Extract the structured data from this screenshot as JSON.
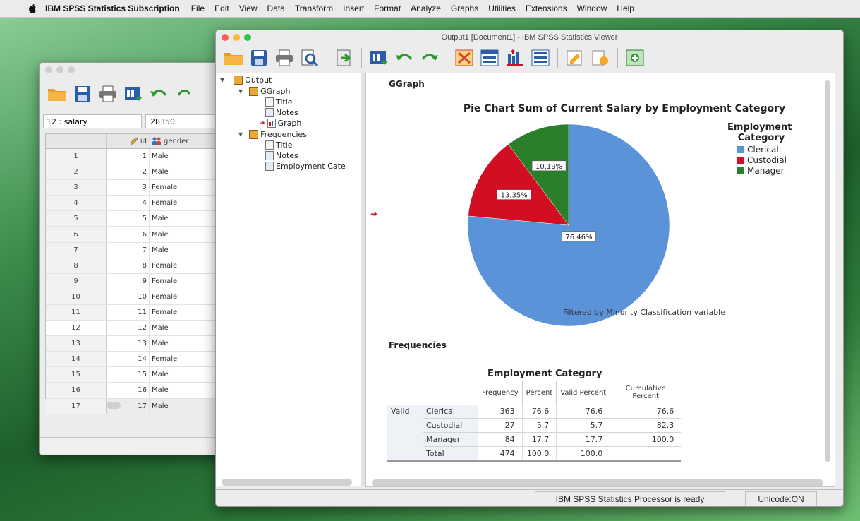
{
  "menubar": {
    "app_name": "IBM SPSS Statistics Subscription",
    "items": [
      "File",
      "Edit",
      "View",
      "Data",
      "Transform",
      "Insert",
      "Format",
      "Analyze",
      "Graphs",
      "Utilities",
      "Extensions",
      "Window",
      "Help"
    ]
  },
  "data_editor": {
    "cell_ref": "12 : salary",
    "cell_value": "28350",
    "columns": {
      "id": "id",
      "gender": "gender"
    },
    "rows": [
      {
        "n": "1",
        "id": "1",
        "gender": "Male"
      },
      {
        "n": "2",
        "id": "2",
        "gender": "Male"
      },
      {
        "n": "3",
        "id": "3",
        "gender": "Female"
      },
      {
        "n": "4",
        "id": "4",
        "gender": "Female"
      },
      {
        "n": "5",
        "id": "5",
        "gender": "Male"
      },
      {
        "n": "6",
        "id": "6",
        "gender": "Male"
      },
      {
        "n": "7",
        "id": "7",
        "gender": "Male"
      },
      {
        "n": "8",
        "id": "8",
        "gender": "Female"
      },
      {
        "n": "9",
        "id": "9",
        "gender": "Female"
      },
      {
        "n": "10",
        "id": "10",
        "gender": "Female"
      },
      {
        "n": "11",
        "id": "11",
        "gender": "Female"
      },
      {
        "n": "12",
        "id": "12",
        "gender": "Male"
      },
      {
        "n": "13",
        "id": "13",
        "gender": "Male"
      },
      {
        "n": "14",
        "id": "14",
        "gender": "Female"
      },
      {
        "n": "15",
        "id": "15",
        "gender": "Male"
      },
      {
        "n": "16",
        "id": "16",
        "gender": "Male"
      },
      {
        "n": "17",
        "id": "17",
        "gender": "Male"
      }
    ]
  },
  "viewer": {
    "title": "Output1 [Document1] - IBM SPSS Statistics Viewer",
    "tree": {
      "output": "Output",
      "ggraph": "GGraph",
      "ggraph_title": "Title",
      "ggraph_notes": "Notes",
      "ggraph_graph": "Graph",
      "frequencies": "Frequencies",
      "freq_title": "Title",
      "freq_notes": "Notes",
      "freq_table": "Employment Cate"
    },
    "section_ggraph": "GGraph",
    "section_frequencies": "Frequencies",
    "status_ready": "IBM SPSS Statistics Processor is ready",
    "status_unicode": "Unicode:ON"
  },
  "chart_data": {
    "type": "pie",
    "title": "Pie Chart Sum of Current Salary by Employment Category",
    "footnote": "Filtered by Minority Classification variable",
    "legend_title": "Employment Category",
    "legend_position": "right",
    "slices": [
      {
        "label": "Clerical",
        "value": 76.46,
        "display": "76.46%",
        "color": "#5b93d9"
      },
      {
        "label": "Custodial",
        "value": 13.35,
        "display": "13.35%",
        "color": "#d20e23"
      },
      {
        "label": "Manager",
        "value": 10.19,
        "display": "10.19%",
        "color": "#2a7f2a"
      }
    ]
  },
  "freq_table": {
    "title": "Employment Category",
    "headers": [
      "Frequency",
      "Percent",
      "Valid Percent",
      "Cumulative Percent"
    ],
    "group_label": "Valid",
    "rows": [
      {
        "label": "Clerical",
        "values": [
          "363",
          "76.6",
          "76.6",
          "76.6"
        ]
      },
      {
        "label": "Custodial",
        "values": [
          "27",
          "5.7",
          "5.7",
          "82.3"
        ]
      },
      {
        "label": "Manager",
        "values": [
          "84",
          "17.7",
          "17.7",
          "100.0"
        ]
      },
      {
        "label": "Total",
        "values": [
          "474",
          "100.0",
          "100.0",
          ""
        ]
      }
    ]
  },
  "colors": {
    "accent_red": "#d20e23",
    "accent_blue": "#5b93d9",
    "accent_green": "#2a7f2a"
  }
}
